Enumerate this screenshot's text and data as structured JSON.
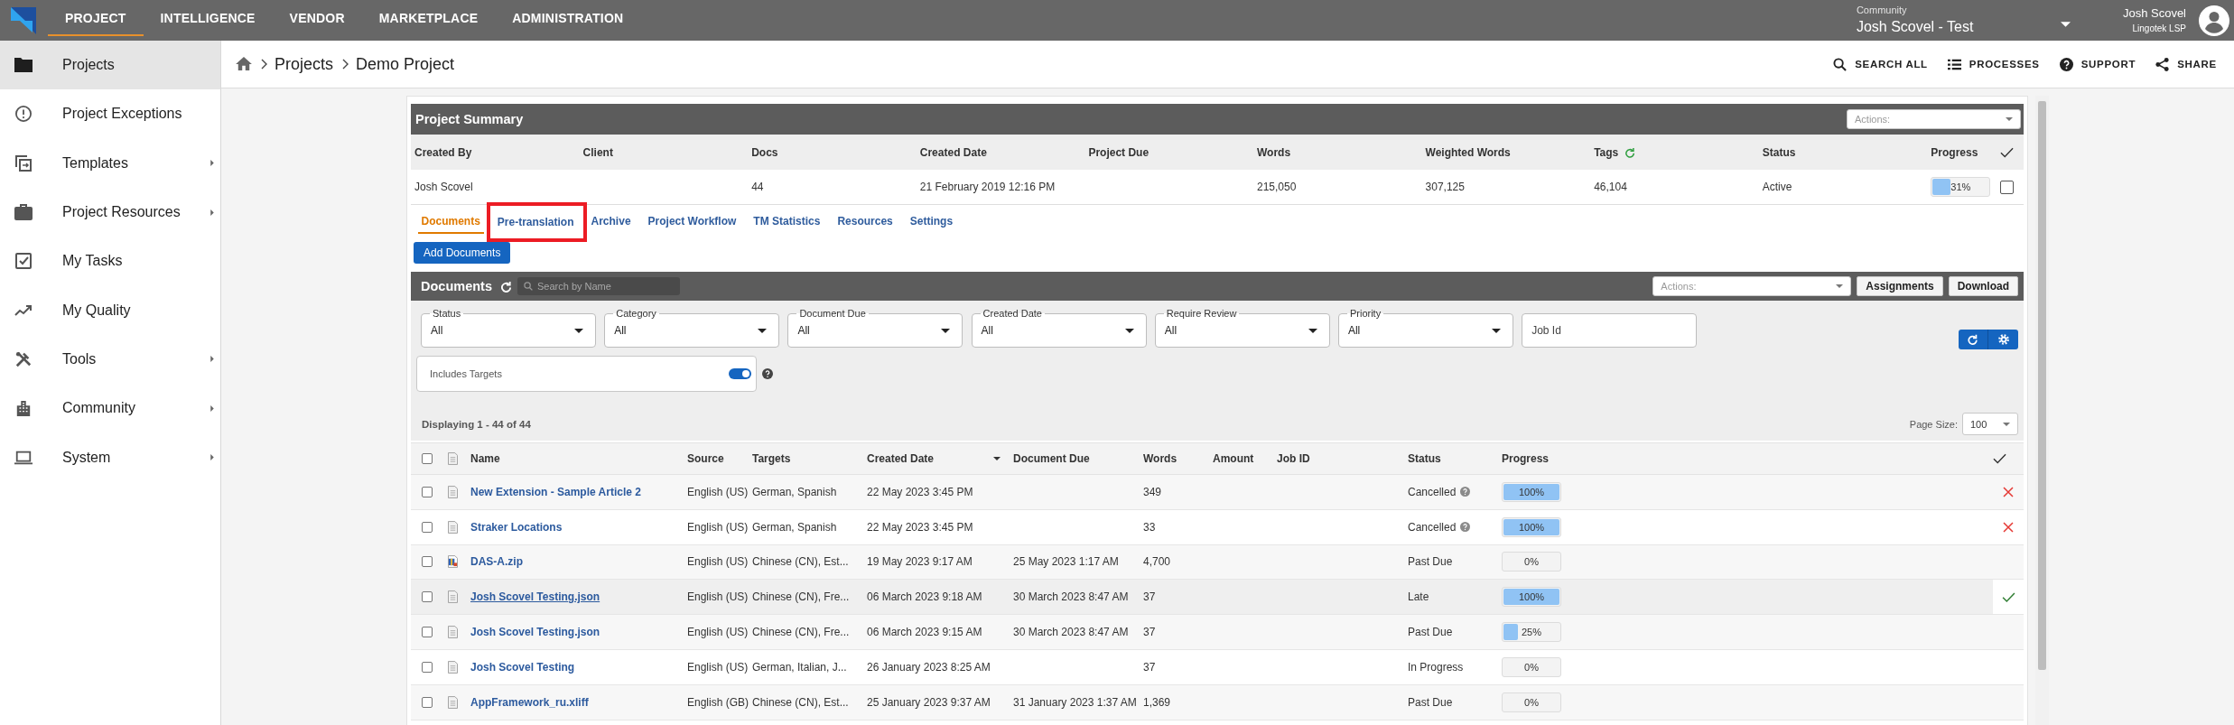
{
  "top_nav": {
    "tabs": [
      {
        "label": "PROJECT",
        "selected": true
      },
      {
        "label": "INTELLIGENCE",
        "selected": false
      },
      {
        "label": "VENDOR",
        "selected": false
      },
      {
        "label": "MARKETPLACE",
        "selected": false
      },
      {
        "label": "ADMINISTRATION",
        "selected": false
      }
    ],
    "community": {
      "label": "Community",
      "value": "Josh Scovel - Test"
    },
    "user": {
      "name": "Josh Scovel",
      "organization": "Lingotek LSP"
    }
  },
  "sidebar": {
    "items": [
      {
        "label": "Projects",
        "selected": true,
        "submenu": false
      },
      {
        "label": "Project Exceptions",
        "selected": false,
        "submenu": false
      },
      {
        "label": "Templates",
        "selected": false,
        "submenu": true
      },
      {
        "label": "Project Resources",
        "selected": false,
        "submenu": true
      },
      {
        "label": "My Tasks",
        "selected": false,
        "submenu": false
      },
      {
        "label": "My Quality",
        "selected": false,
        "submenu": false
      },
      {
        "label": "Tools",
        "selected": false,
        "submenu": true
      },
      {
        "label": "Community",
        "selected": false,
        "submenu": true
      },
      {
        "label": "System",
        "selected": false,
        "submenu": true
      }
    ]
  },
  "breadcrumb": [
    "Projects",
    "Demo Project"
  ],
  "header_actions": [
    "SEARCH ALL",
    "PROCESSES",
    "SUPPORT",
    "SHARE"
  ],
  "project_summary": {
    "title": "Project Summary",
    "actions_placeholder": "Actions:",
    "columns": [
      "Created By",
      "Client",
      "Docs",
      "Created Date",
      "Project Due",
      "Words",
      "Weighted Words",
      "Tags",
      "Status",
      "Progress"
    ],
    "row": {
      "cells": [
        "Josh Scovel",
        null,
        "44",
        "21 February 2019 12:16 PM",
        null,
        "215,050",
        "307,125",
        "46,104",
        "Active"
      ],
      "progress": {
        "level": 0.31,
        "reading": "31%"
      },
      "checked": false
    }
  },
  "tabs": [
    {
      "label": "Documents",
      "selected": true,
      "highlighted": false
    },
    {
      "label": "Pre-translation",
      "selected": false,
      "highlighted": true
    },
    {
      "label": "Archive",
      "selected": false,
      "highlighted": false
    },
    {
      "label": "Project Workflow",
      "selected": false,
      "highlighted": false
    },
    {
      "label": "TM Statistics",
      "selected": false,
      "highlighted": false
    },
    {
      "label": "Resources",
      "selected": false,
      "highlighted": false
    },
    {
      "label": "Settings",
      "selected": false,
      "highlighted": false
    }
  ],
  "add_button": "Add Documents",
  "documents": {
    "title": "Documents",
    "search_placeholder": "Search by Name",
    "actions_placeholder": "Actions:",
    "buttons": [
      "Assignments",
      "Download"
    ],
    "filters": [
      {
        "kind": "select",
        "label": "Status",
        "value": "All"
      },
      {
        "kind": "select",
        "label": "Category",
        "value": "All"
      },
      {
        "kind": "select",
        "label": "Document Due",
        "value": "All"
      },
      {
        "kind": "select",
        "label": "Created Date",
        "value": "All"
      },
      {
        "kind": "select",
        "label": "Require Review",
        "value": "All"
      },
      {
        "kind": "select",
        "label": "Priority",
        "value": "All"
      },
      {
        "kind": "text",
        "placeholder": "Job Id"
      }
    ],
    "includes_targets": {
      "label": "Includes Targets",
      "on": true
    },
    "count": "Displaying 1 - 44 of 44",
    "page_size": {
      "label": "Page Size:",
      "value": "100"
    },
    "all_checked": false,
    "columns": [
      {
        "label": "Name",
        "sorted": false
      },
      {
        "label": "Source",
        "sorted": false
      },
      {
        "label": "Targets",
        "sorted": false
      },
      {
        "label": "Created Date",
        "sorted": true
      },
      {
        "label": "Document Due",
        "sorted": false
      },
      {
        "label": "Words",
        "sorted": false
      },
      {
        "label": "Amount",
        "sorted": false
      },
      {
        "label": "Job ID",
        "sorted": false
      },
      {
        "label": "Status",
        "sorted": false
      },
      {
        "label": "Progress",
        "sorted": false
      }
    ],
    "rows": [
      {
        "kind": "document",
        "name": "New Extension - Sample Article 2",
        "source": "English (US)",
        "targets": "German, Spanish",
        "created_date": "22 May 2023 3:45 PM",
        "words": "349",
        "status": "Cancelled",
        "status_info": true,
        "progress": {
          "level": 1,
          "reading": "100%"
        },
        "rejected": true,
        "approved": false,
        "checked": false,
        "hovered": false
      },
      {
        "kind": "document",
        "name": "Straker Locations",
        "source": "English (US)",
        "targets": "German, Spanish",
        "created_date": "22 May 2023 3:45 PM",
        "words": "33",
        "status": "Cancelled",
        "status_info": true,
        "progress": {
          "level": 1,
          "reading": "100%"
        },
        "rejected": true,
        "approved": false,
        "checked": false,
        "hovered": false
      },
      {
        "kind": "archive",
        "name": "DAS-A.zip",
        "source": "English (US)",
        "targets": "Chinese (CN), Est...",
        "created_date": "19 May 2023 9:17 AM",
        "document_due": "25 May 2023 1:17 AM",
        "words": "4,700",
        "status": "Past Due",
        "status_info": false,
        "progress": {
          "level": 0,
          "reading": "0%"
        },
        "rejected": false,
        "approved": false,
        "checked": false,
        "hovered": false
      },
      {
        "kind": "document",
        "name": "Josh Scovel Testing.json",
        "source": "English (US)",
        "targets": "Chinese (CN), Fre...",
        "created_date": "06 March 2023 9:18 AM",
        "document_due": "30 March 2023 8:47 AM",
        "words": "37",
        "status": "Late",
        "status_info": false,
        "progress": {
          "level": 1,
          "reading": "100%"
        },
        "rejected": false,
        "approved": true,
        "checked": false,
        "hovered": true
      },
      {
        "kind": "document",
        "name": "Josh Scovel Testing.json",
        "source": "English (US)",
        "targets": "Chinese (CN), Fre...",
        "created_date": "06 March 2023 9:15 AM",
        "document_due": "30 March 2023 8:47 AM",
        "words": "37",
        "status": "Past Due",
        "status_info": false,
        "progress": {
          "level": 0.25,
          "reading": "25%"
        },
        "rejected": false,
        "approved": false,
        "checked": false,
        "hovered": false
      },
      {
        "kind": "document",
        "name": "Josh Scovel Testing",
        "source": "English (US)",
        "targets": "German, Italian, J...",
        "created_date": "26 January 2023 8:25 AM",
        "words": "37",
        "status": "In Progress",
        "status_info": false,
        "progress": {
          "level": 0,
          "reading": "0%"
        },
        "rejected": false,
        "approved": false,
        "checked": false,
        "hovered": false
      },
      {
        "kind": "document",
        "name": "AppFramework_ru.xliff",
        "source": "English (GB)",
        "targets": "Chinese (CN), Est...",
        "created_date": "25 January 2023 9:37 AM",
        "document_due": "31 January 2023 1:37 AM",
        "words": "1,369",
        "status": "Past Due",
        "status_info": false,
        "progress": {
          "level": 0,
          "reading": "0%"
        },
        "rejected": false,
        "approved": false,
        "checked": false,
        "hovered": false
      }
    ]
  }
}
